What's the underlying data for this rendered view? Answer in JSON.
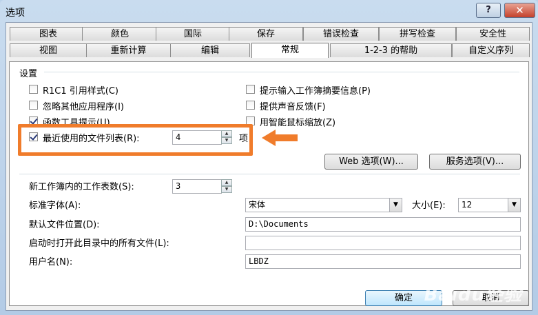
{
  "window": {
    "title": "选项",
    "help_label": "?",
    "close_label": "✕"
  },
  "tabs_row1": [
    "图表",
    "颜色",
    "国际",
    "保存",
    "错误检查",
    "拼写检查",
    "安全性"
  ],
  "tabs_row2": [
    "视图",
    "重新计算",
    "编辑",
    "常规",
    "1-2-3 的帮助",
    "自定义序列"
  ],
  "active_tab": "常规",
  "settings": {
    "group_label": "设置",
    "r1c1": {
      "label": "R1C1 引用样式(C)",
      "checked": false
    },
    "ignore_apps": {
      "label": "忽略其他应用程序(I)",
      "checked": false
    },
    "func_tips": {
      "label": "函数工具提示(U)",
      "checked": true
    },
    "recent_files": {
      "label": "最近使用的文件列表(R):",
      "checked": true,
      "value": "4",
      "unit": "项"
    },
    "prompt_props": {
      "label": "提示输入工作簿摘要信息(P)",
      "checked": false
    },
    "sound_feedback": {
      "label": "提供声音反馈(F)",
      "checked": false
    },
    "zoom_mouse": {
      "label": "用智能鼠标缩放(Z)",
      "checked": false
    }
  },
  "buttons": {
    "web_options": "Web 选项(W)...",
    "service_options": "服务选项(V)...",
    "ok": "确定",
    "cancel": "取消"
  },
  "fields": {
    "sheets_label": "新工作簿内的工作表数(S):",
    "sheets_value": "3",
    "font_label": "标准字体(A):",
    "font_value": "宋体",
    "size_label": "大小(E):",
    "size_value": "12",
    "default_path_label": "默认文件位置(D):",
    "default_path_value": "D:\\Documents",
    "startup_label": "启动时打开此目录中的所有文件(L):",
    "startup_value": "",
    "username_label": "用户名(N):",
    "username_value": "LBDZ"
  },
  "watermark": {
    "text": "Baidu经验",
    "sub": "jingyan.baidu.com"
  },
  "colors": {
    "highlight": "#f07c2b",
    "accent": "#3c7fb1"
  }
}
